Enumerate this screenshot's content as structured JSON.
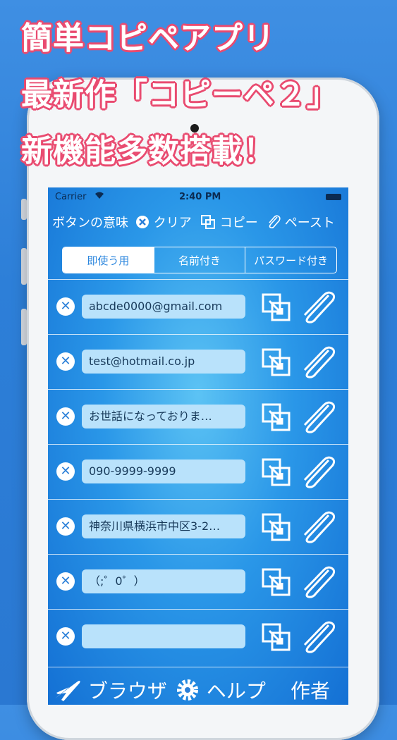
{
  "promo": {
    "line1": "簡単コピペアプリ",
    "line2": "最新作「コピーペ２」",
    "line3": "新機能多数搭載！"
  },
  "status_bar": {
    "carrier": "Carrier",
    "time": "2:40 PM"
  },
  "toolbar": {
    "button_meaning": "ボタンの意味",
    "clear": "クリア",
    "copy": "コピー",
    "paste": "ペースト"
  },
  "tabs": [
    {
      "label": "即使う用",
      "active": true
    },
    {
      "label": "名前付き",
      "active": false
    },
    {
      "label": "パスワード付き",
      "active": false
    }
  ],
  "entries": [
    {
      "value": "abcde0000@gmail.com"
    },
    {
      "value": "test@hotmail.co.jp"
    },
    {
      "value": "お世話になっておりま…"
    },
    {
      "value": "090-9999-9999"
    },
    {
      "value": "神奈川県横浜市中区3-2…"
    },
    {
      "value": "（;゜0゜）"
    },
    {
      "value": ""
    }
  ],
  "bottom_bar": {
    "browser": "ブラウザ",
    "help": "ヘルプ",
    "author": "作者"
  },
  "colors": {
    "promo_outline": "#e94b70",
    "screen_blue": "#2a97e8",
    "field_bg": "#b9e2fb"
  }
}
